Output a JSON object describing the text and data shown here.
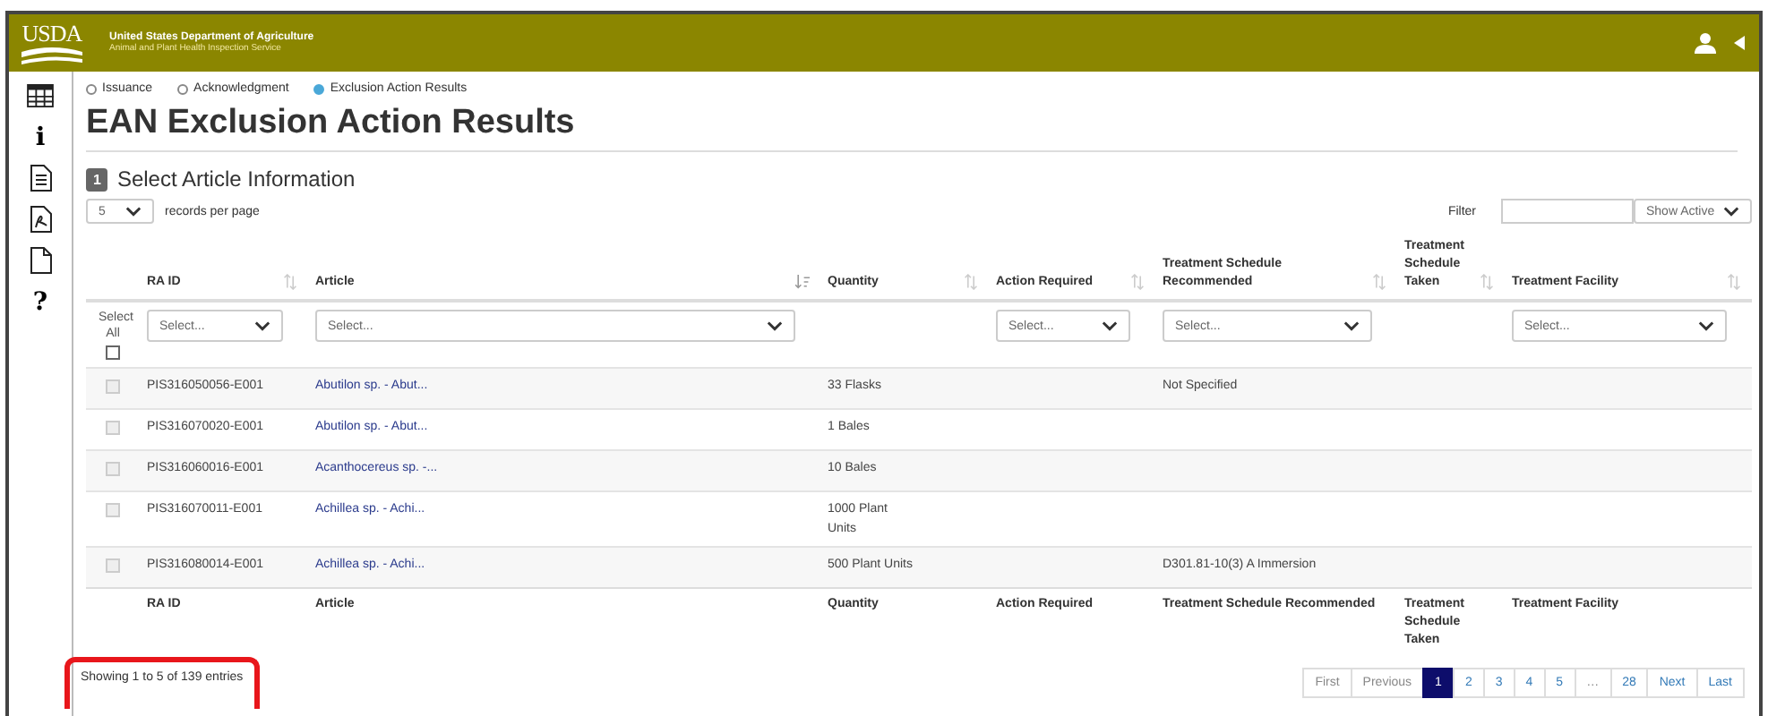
{
  "header": {
    "logo": "USDA",
    "title": "United States Department of Agriculture",
    "subtitle": "Animal and Plant Health Inspection Service"
  },
  "sidebar": {
    "items": [
      {
        "kind": "table"
      },
      {
        "kind": "glyph",
        "glyph": "i"
      },
      {
        "kind": "doc"
      },
      {
        "kind": "pdf"
      },
      {
        "kind": "blank"
      },
      {
        "kind": "glyph",
        "glyph": "?"
      }
    ]
  },
  "steps": [
    {
      "label": "Issuance",
      "selected": false
    },
    {
      "label": "Acknowledgment",
      "selected": false
    },
    {
      "label": "Exclusion Action Results",
      "selected": true
    }
  ],
  "page_title": "EAN Exclusion Action Results",
  "section": {
    "number": "1",
    "title": "Select Article Information"
  },
  "page_size": {
    "value": "5",
    "label": "records per page"
  },
  "filter": {
    "label": "Filter",
    "status": "Show Active"
  },
  "table": {
    "select_all": "Select All",
    "select_all_checked": false,
    "columns": [
      {
        "label": "RA ID",
        "sorted": false,
        "filter": "Select..."
      },
      {
        "label": "Article",
        "sorted": true,
        "filter": "Select..."
      },
      {
        "label": "Quantity",
        "sorted": false
      },
      {
        "label": "Action Required",
        "sorted": false,
        "filter": "Select..."
      },
      {
        "label": "Treatment Schedule Recommended",
        "sorted": false,
        "filter": "Select..."
      },
      {
        "label": "Treatment Schedule Taken",
        "sorted": false
      },
      {
        "label": "Treatment Facility",
        "sorted": false,
        "filter": "Select..."
      }
    ],
    "rows": [
      {
        "checked": false,
        "cells": [
          "PIS316050056-E001",
          "Abutilon sp. - Abut...",
          "33 Flasks",
          "",
          "Not Specified",
          "",
          ""
        ]
      },
      {
        "checked": false,
        "cells": [
          "PIS316070020-E001",
          "Abutilon sp. - Abut...",
          "1 Bales",
          "",
          "",
          "",
          ""
        ]
      },
      {
        "checked": false,
        "cells": [
          "PIS316060016-E001",
          "Acanthocereus sp. -...",
          "10 Bales",
          "",
          "",
          "",
          ""
        ]
      },
      {
        "checked": false,
        "cells": [
          "PIS316070011-E001",
          "Achillea sp. - Achi...",
          "1000 Plant Units",
          "",
          "",
          "",
          ""
        ]
      },
      {
        "checked": false,
        "cells": [
          "PIS316080014-E001",
          "Achillea sp. - Achi...",
          "500 Plant Units",
          "",
          "D301.81-10(3) A Immersion",
          "",
          ""
        ]
      }
    ],
    "footer_columns": [
      "RA ID",
      "Article",
      "Quantity",
      "Action Required",
      "Treatment Schedule Recommended",
      "Treatment Schedule Taken",
      "Treatment Facility"
    ]
  },
  "entries_info": {
    "text": "Showing 1 to 5 of 139 entries",
    "highlighted": true
  },
  "pagination": [
    {
      "label": "First",
      "disabled": true,
      "selected": false
    },
    {
      "label": "Previous",
      "disabled": true,
      "selected": false
    },
    {
      "label": "1",
      "disabled": false,
      "selected": true
    },
    {
      "label": "2",
      "disabled": false,
      "selected": false
    },
    {
      "label": "3",
      "disabled": false,
      "selected": false
    },
    {
      "label": "4",
      "disabled": false,
      "selected": false
    },
    {
      "label": "5",
      "disabled": false,
      "selected": false
    },
    {
      "label": "…",
      "disabled": true,
      "selected": false
    },
    {
      "label": "28",
      "disabled": false,
      "selected": false
    },
    {
      "label": "Next",
      "disabled": false,
      "selected": false
    },
    {
      "label": "Last",
      "disabled": false,
      "selected": false
    }
  ]
}
